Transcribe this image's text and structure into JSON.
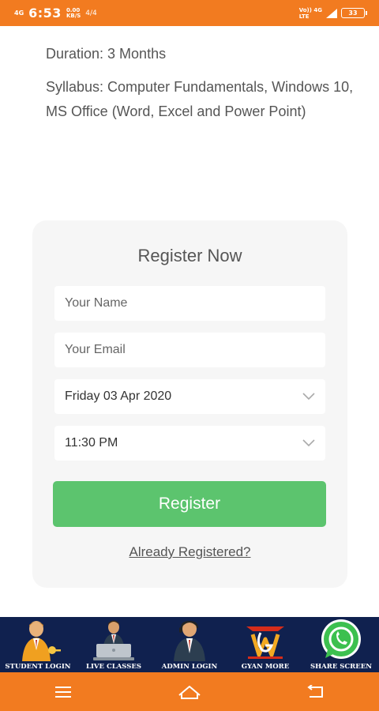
{
  "status_bar": {
    "network": "4G",
    "time": "6:53",
    "speed_value": "0.00",
    "speed_unit": "KB/S",
    "misc": "4/4",
    "volte_top": "Vo)) 4G",
    "volte_bottom": "LTE",
    "battery": "33"
  },
  "course": {
    "duration": "Duration: 3 Months",
    "syllabus": "Syllabus:  Computer Fundamentals, Windows 10, MS Office (Word, Excel and Power Point)"
  },
  "register": {
    "title": "Register Now",
    "name_placeholder": "Your Name",
    "email_placeholder": "Your Email",
    "date_value": "Friday 03 Apr 2020",
    "time_value": "11:30 PM",
    "button_label": "Register",
    "already_link": "Already Registered?"
  },
  "bottom_nav": {
    "items": [
      {
        "label": "STUDENT LOGIN",
        "icon": "student-icon"
      },
      {
        "label": "LIVE CLASSES",
        "icon": "laptop-teacher-icon"
      },
      {
        "label": "ADMIN LOGIN",
        "icon": "admin-icon"
      },
      {
        "label": "GYAN MORE",
        "icon": "gyan-more-logo-icon"
      },
      {
        "label": "SHARE SCREEN",
        "icon": "whatsapp-icon"
      }
    ]
  },
  "colors": {
    "accent": "#f27b20",
    "nav_bg": "#10214f",
    "button": "#5cc46e",
    "card_bg": "#f6f6f6"
  }
}
